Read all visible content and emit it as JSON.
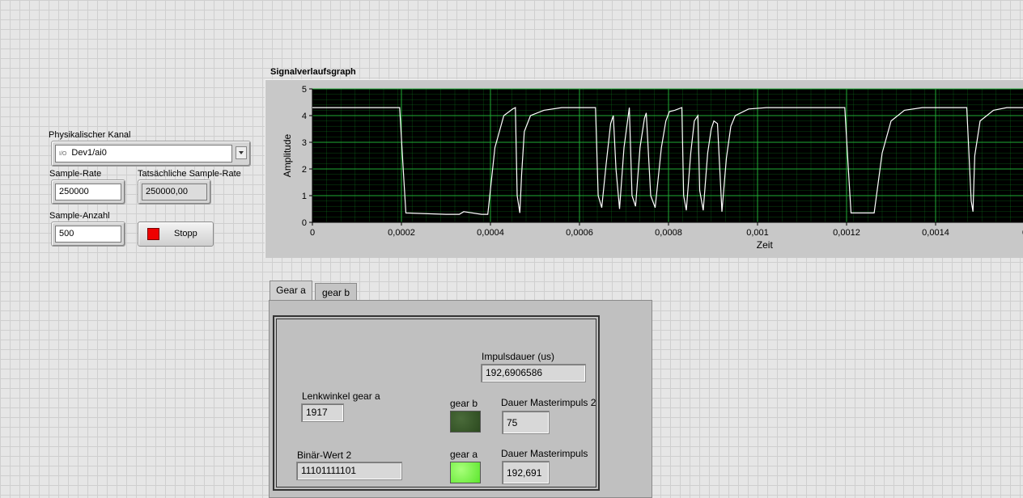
{
  "controls": {
    "channel_label": "Physikalischer Kanal",
    "channel_prefix": "I/O",
    "channel_value": "Dev1/ai0",
    "sample_rate_label": "Sample-Rate",
    "sample_rate_value": "250000",
    "actual_rate_label": "Tatsächliche Sample-Rate",
    "actual_rate_value": "250000,00",
    "sample_count_label": "Sample-Anzahl",
    "sample_count_value": "500",
    "stop_label": "Stopp"
  },
  "graph": {
    "title": "Signalverlaufsgraph",
    "colors": {
      "plot_bg": "#000000",
      "grid": "#0f7a1e",
      "trace": "#ffffff"
    }
  },
  "chart_data": {
    "type": "line",
    "title": "Signalverlaufsgraph",
    "xlabel": "Zeit",
    "ylabel": "Amplitude",
    "xlim": [
      0,
      0.0016
    ],
    "ylim": [
      0,
      5
    ],
    "x_ticks": [
      "0",
      "0,0002",
      "0,0004",
      "0,0006",
      "0,0008",
      "0,001",
      "0,0012",
      "0,0014",
      "0"
    ],
    "y_ticks": [
      "0",
      "1",
      "2",
      "3",
      "4",
      "5"
    ],
    "grid": true,
    "series": [
      {
        "x": [
          0,
          0.000196,
          0.000204,
          0.00021,
          0.0003,
          0.00033,
          0.00034,
          0.00038,
          0.00039,
          0.000394,
          0.00041,
          0.00043,
          0.00045,
          0.000456,
          0.00046,
          0.000466,
          0.00047,
          0.000476,
          0.00049,
          0.00052,
          0.00056,
          0.00062,
          0.000636,
          0.000642,
          0.00065,
          0.00066,
          0.00067,
          0.000676,
          0.000682,
          0.00069,
          0.0007,
          0.000712,
          0.000718,
          0.000726,
          0.000736,
          0.000746,
          0.00075,
          0.00076,
          0.00077,
          0.000784,
          0.000794,
          0.000802,
          0.000814,
          0.00083,
          0.000834,
          0.00084,
          0.00085,
          0.000858,
          0.000866,
          0.00087,
          0.000878,
          0.000888,
          0.000896,
          0.000902,
          0.00091,
          0.00092,
          0.00093,
          0.00094,
          0.00095,
          0.00098,
          0.00102,
          0.00108,
          0.001196,
          0.001204,
          0.00121,
          0.00125,
          0.001262,
          0.00128,
          0.0013,
          0.00133,
          0.00137,
          0.00147,
          0.00148,
          0.001484,
          0.001488,
          0.0015,
          0.00153,
          0.00156,
          0.0016
        ],
        "y": [
          4.3,
          4.3,
          2.0,
          0.35,
          0.3,
          0.3,
          0.4,
          0.3,
          0.3,
          0.3,
          2.8,
          4.0,
          4.25,
          4.3,
          1.0,
          0.35,
          1.8,
          3.4,
          4.0,
          4.2,
          4.3,
          4.3,
          4.3,
          1.0,
          0.55,
          2.2,
          3.7,
          4.0,
          2.0,
          0.5,
          2.8,
          4.3,
          1.0,
          0.6,
          2.8,
          3.9,
          4.1,
          1.0,
          0.55,
          2.8,
          3.8,
          4.15,
          4.2,
          4.3,
          1.0,
          0.45,
          2.6,
          3.8,
          4.0,
          1.2,
          0.45,
          2.6,
          3.5,
          3.8,
          3.7,
          0.4,
          2.4,
          3.6,
          4.0,
          4.25,
          4.3,
          4.3,
          4.3,
          2.0,
          0.35,
          0.35,
          0.35,
          2.6,
          3.8,
          4.2,
          4.3,
          4.3,
          0.8,
          0.4,
          2.5,
          3.8,
          4.2,
          4.3,
          4.3
        ]
      }
    ]
  },
  "tabs": [
    {
      "label": "Gear a",
      "active": true
    },
    {
      "label": "gear b",
      "active": false
    }
  ],
  "panel": {
    "impuls_label": "Impulsdauer (us)",
    "impuls_value": "192,6906586",
    "lenkwinkel_label": "Lenkwinkel gear a",
    "lenkwinkel_value": "1917",
    "binaer_label": "Binär-Wert 2",
    "binaer_value": "11101111101",
    "led_b_label": "gear b",
    "led_a_label": "gear a",
    "dauer2_label": "Dauer Masterimpuls 2",
    "dauer2_value": "75",
    "dauer_label": "Dauer Masterimpuls",
    "dauer_value": "192,691",
    "colors": {
      "led_off": "#2c4a1f",
      "led_on": "#5ce62e"
    }
  }
}
